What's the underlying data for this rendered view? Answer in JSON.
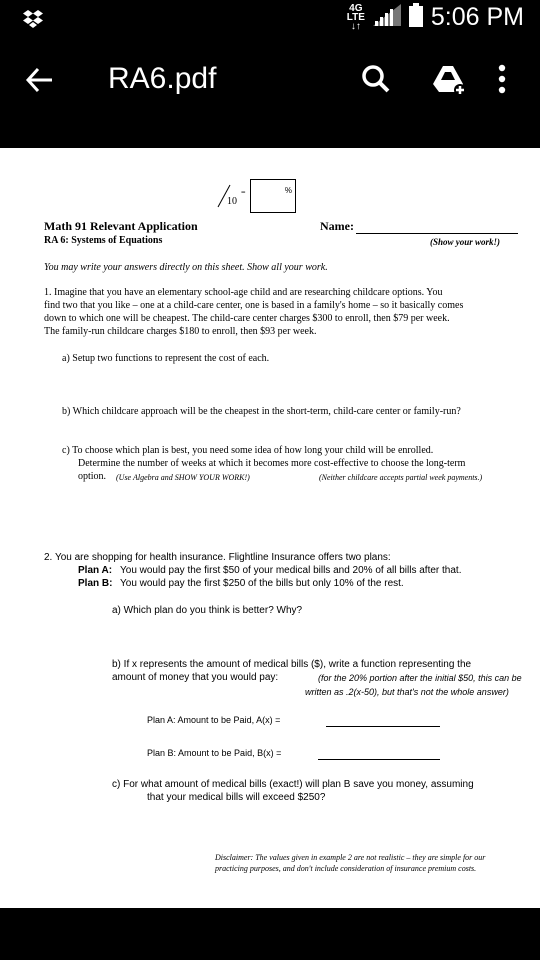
{
  "status": {
    "time": "5:06 PM",
    "network": "4G LTE"
  },
  "toolbar": {
    "title": "RA6.pdf"
  },
  "doc": {
    "score": {
      "denominator": "10",
      "equals": "=",
      "percent": "%"
    },
    "heading": {
      "course": "Math 91 Relevant Application",
      "subtitle": "RA 6: Systems of Equations",
      "name_label": "Name:",
      "show_work": "(Show your work!)"
    },
    "instructions": "You may write your answers directly on this sheet.  Show all your work.",
    "p1": {
      "lines": [
        "1.  Imagine that you have an elementary school-age child and are researching childcare options.  You",
        "find two that you like – one at a child-care center, one is based in a family's home – so it basically comes",
        "down to which one will be cheapest.  The child-care center charges $300 to enroll, then $79 per week.",
        "The family-run childcare charges $180 to enroll, then $93 per week."
      ],
      "a": "a)   Setup two functions to represent the cost of each.",
      "b": "b)   Which childcare approach will be the cheapest in the short-term, child-care center or family-run?",
      "c_lines": [
        "c)   To choose which plan is best, you need some idea of how long your child will be enrolled.",
        "Determine the number of weeks at which it becomes more cost-effective to choose the long-term",
        "option."
      ],
      "c_note1": "(Use Algebra and SHOW YOUR WORK!)",
      "c_note2": "(Neither childcare accepts partial week payments.)"
    },
    "p2": {
      "intro": "2.  You are shopping for health insurance.  Flightline Insurance offers two plans:",
      "planA_label": "Plan A:",
      "planA_text": "You would pay the first $50 of your medical bills and 20% of all bills after that.",
      "planB_label": "Plan B:",
      "planB_text": "You would pay the first $250 of the bills but only 10% of the rest.",
      "a": "a)  Which plan do you think is better?  Why?",
      "b_line1": "b)  If x represents the amount of medical bills ($), write a function representing the",
      "b_line2": "amount of money that you would pay:",
      "b_hint1": "(for the 20% portion after the initial $50, this can be",
      "b_hint2": "written as .2(x-50), but that's not the whole answer)",
      "fA": "Plan A:  Amount to be Paid,  A(x) =",
      "fB": "Plan B:  Amount to be Paid,  B(x) =",
      "c_line1": "c)  For what amount of medical bills (exact!) will plan B save you money, assuming",
      "c_line2": "that your medical bills will exceed $250?"
    },
    "disclaimer": {
      "line1": "Disclaimer: The values given in example 2 are not realistic – they are simple for our",
      "line2": "practicing purposes, and don't include consideration of insurance premium costs."
    }
  }
}
